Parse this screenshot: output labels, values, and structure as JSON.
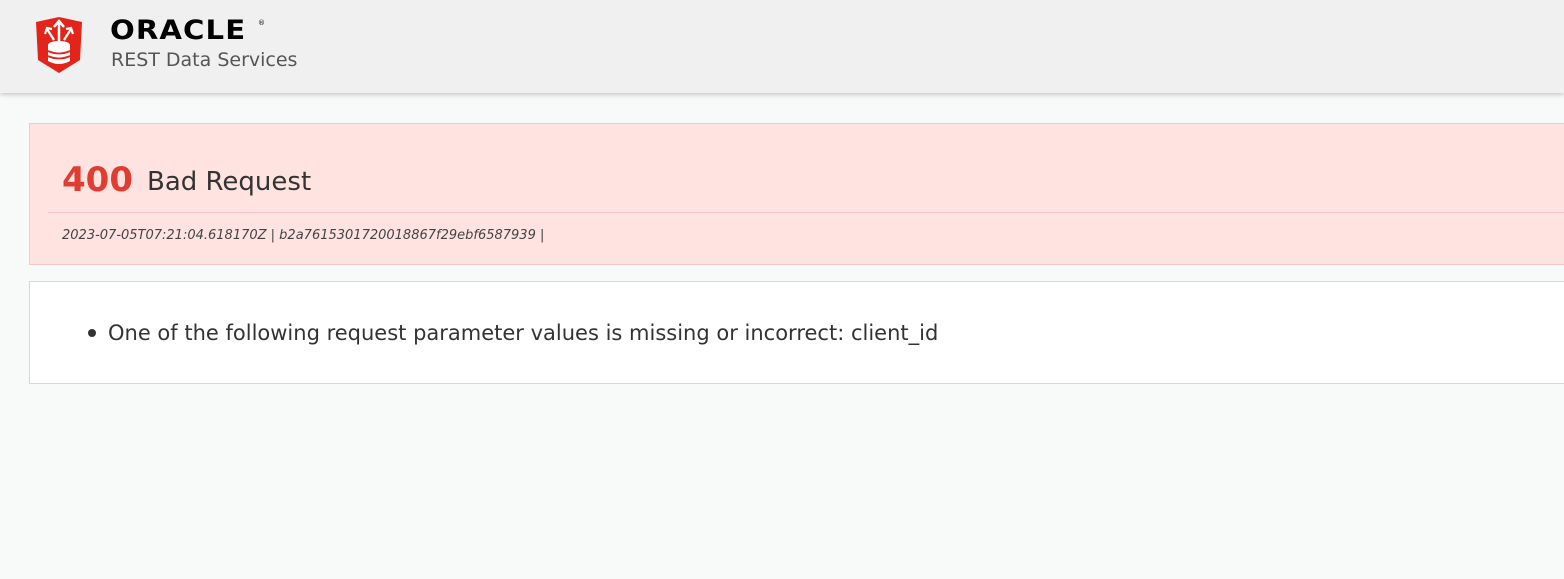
{
  "header": {
    "brand_name": "ORACLE",
    "brand_mark": "®",
    "product_name": "REST Data Services",
    "logo_icon": "database-shield-icon"
  },
  "error": {
    "status_code": "400",
    "status_text": "Bad Request",
    "meta": "2023-07-05T07:21:04.618170Z | b2a7615301720018867f29ebf6587939 |",
    "status_color": "#e03c31",
    "banner_color": "#ffe3e0"
  },
  "details": {
    "items": [
      {
        "text": "One of the following request parameter values is missing or incorrect: client_id"
      }
    ]
  },
  "colors": {
    "logo_red": "#e3241b",
    "header_bg": "#f0f0f0",
    "page_bg": "#f8f9f9"
  }
}
